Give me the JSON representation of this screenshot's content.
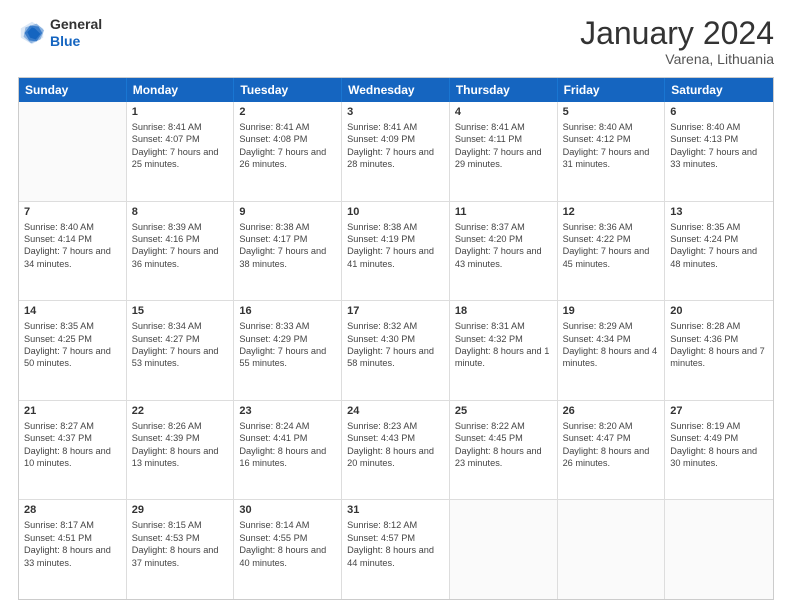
{
  "header": {
    "logo_general": "General",
    "logo_blue": "Blue",
    "month_title": "January 2024",
    "location": "Varena, Lithuania"
  },
  "days_of_week": [
    "Sunday",
    "Monday",
    "Tuesday",
    "Wednesday",
    "Thursday",
    "Friday",
    "Saturday"
  ],
  "weeks": [
    [
      {
        "day": "",
        "empty": true
      },
      {
        "day": "1",
        "sunrise": "Sunrise: 8:41 AM",
        "sunset": "Sunset: 4:07 PM",
        "daylight": "Daylight: 7 hours and 25 minutes."
      },
      {
        "day": "2",
        "sunrise": "Sunrise: 8:41 AM",
        "sunset": "Sunset: 4:08 PM",
        "daylight": "Daylight: 7 hours and 26 minutes."
      },
      {
        "day": "3",
        "sunrise": "Sunrise: 8:41 AM",
        "sunset": "Sunset: 4:09 PM",
        "daylight": "Daylight: 7 hours and 28 minutes."
      },
      {
        "day": "4",
        "sunrise": "Sunrise: 8:41 AM",
        "sunset": "Sunset: 4:11 PM",
        "daylight": "Daylight: 7 hours and 29 minutes."
      },
      {
        "day": "5",
        "sunrise": "Sunrise: 8:40 AM",
        "sunset": "Sunset: 4:12 PM",
        "daylight": "Daylight: 7 hours and 31 minutes."
      },
      {
        "day": "6",
        "sunrise": "Sunrise: 8:40 AM",
        "sunset": "Sunset: 4:13 PM",
        "daylight": "Daylight: 7 hours and 33 minutes."
      }
    ],
    [
      {
        "day": "7",
        "sunrise": "Sunrise: 8:40 AM",
        "sunset": "Sunset: 4:14 PM",
        "daylight": "Daylight: 7 hours and 34 minutes."
      },
      {
        "day": "8",
        "sunrise": "Sunrise: 8:39 AM",
        "sunset": "Sunset: 4:16 PM",
        "daylight": "Daylight: 7 hours and 36 minutes."
      },
      {
        "day": "9",
        "sunrise": "Sunrise: 8:38 AM",
        "sunset": "Sunset: 4:17 PM",
        "daylight": "Daylight: 7 hours and 38 minutes."
      },
      {
        "day": "10",
        "sunrise": "Sunrise: 8:38 AM",
        "sunset": "Sunset: 4:19 PM",
        "daylight": "Daylight: 7 hours and 41 minutes."
      },
      {
        "day": "11",
        "sunrise": "Sunrise: 8:37 AM",
        "sunset": "Sunset: 4:20 PM",
        "daylight": "Daylight: 7 hours and 43 minutes."
      },
      {
        "day": "12",
        "sunrise": "Sunrise: 8:36 AM",
        "sunset": "Sunset: 4:22 PM",
        "daylight": "Daylight: 7 hours and 45 minutes."
      },
      {
        "day": "13",
        "sunrise": "Sunrise: 8:35 AM",
        "sunset": "Sunset: 4:24 PM",
        "daylight": "Daylight: 7 hours and 48 minutes."
      }
    ],
    [
      {
        "day": "14",
        "sunrise": "Sunrise: 8:35 AM",
        "sunset": "Sunset: 4:25 PM",
        "daylight": "Daylight: 7 hours and 50 minutes."
      },
      {
        "day": "15",
        "sunrise": "Sunrise: 8:34 AM",
        "sunset": "Sunset: 4:27 PM",
        "daylight": "Daylight: 7 hours and 53 minutes."
      },
      {
        "day": "16",
        "sunrise": "Sunrise: 8:33 AM",
        "sunset": "Sunset: 4:29 PM",
        "daylight": "Daylight: 7 hours and 55 minutes."
      },
      {
        "day": "17",
        "sunrise": "Sunrise: 8:32 AM",
        "sunset": "Sunset: 4:30 PM",
        "daylight": "Daylight: 7 hours and 58 minutes."
      },
      {
        "day": "18",
        "sunrise": "Sunrise: 8:31 AM",
        "sunset": "Sunset: 4:32 PM",
        "daylight": "Daylight: 8 hours and 1 minute."
      },
      {
        "day": "19",
        "sunrise": "Sunrise: 8:29 AM",
        "sunset": "Sunset: 4:34 PM",
        "daylight": "Daylight: 8 hours and 4 minutes."
      },
      {
        "day": "20",
        "sunrise": "Sunrise: 8:28 AM",
        "sunset": "Sunset: 4:36 PM",
        "daylight": "Daylight: 8 hours and 7 minutes."
      }
    ],
    [
      {
        "day": "21",
        "sunrise": "Sunrise: 8:27 AM",
        "sunset": "Sunset: 4:37 PM",
        "daylight": "Daylight: 8 hours and 10 minutes."
      },
      {
        "day": "22",
        "sunrise": "Sunrise: 8:26 AM",
        "sunset": "Sunset: 4:39 PM",
        "daylight": "Daylight: 8 hours and 13 minutes."
      },
      {
        "day": "23",
        "sunrise": "Sunrise: 8:24 AM",
        "sunset": "Sunset: 4:41 PM",
        "daylight": "Daylight: 8 hours and 16 minutes."
      },
      {
        "day": "24",
        "sunrise": "Sunrise: 8:23 AM",
        "sunset": "Sunset: 4:43 PM",
        "daylight": "Daylight: 8 hours and 20 minutes."
      },
      {
        "day": "25",
        "sunrise": "Sunrise: 8:22 AM",
        "sunset": "Sunset: 4:45 PM",
        "daylight": "Daylight: 8 hours and 23 minutes."
      },
      {
        "day": "26",
        "sunrise": "Sunrise: 8:20 AM",
        "sunset": "Sunset: 4:47 PM",
        "daylight": "Daylight: 8 hours and 26 minutes."
      },
      {
        "day": "27",
        "sunrise": "Sunrise: 8:19 AM",
        "sunset": "Sunset: 4:49 PM",
        "daylight": "Daylight: 8 hours and 30 minutes."
      }
    ],
    [
      {
        "day": "28",
        "sunrise": "Sunrise: 8:17 AM",
        "sunset": "Sunset: 4:51 PM",
        "daylight": "Daylight: 8 hours and 33 minutes."
      },
      {
        "day": "29",
        "sunrise": "Sunrise: 8:15 AM",
        "sunset": "Sunset: 4:53 PM",
        "daylight": "Daylight: 8 hours and 37 minutes."
      },
      {
        "day": "30",
        "sunrise": "Sunrise: 8:14 AM",
        "sunset": "Sunset: 4:55 PM",
        "daylight": "Daylight: 8 hours and 40 minutes."
      },
      {
        "day": "31",
        "sunrise": "Sunrise: 8:12 AM",
        "sunset": "Sunset: 4:57 PM",
        "daylight": "Daylight: 8 hours and 44 minutes."
      },
      {
        "day": "",
        "empty": true
      },
      {
        "day": "",
        "empty": true
      },
      {
        "day": "",
        "empty": true
      }
    ]
  ]
}
